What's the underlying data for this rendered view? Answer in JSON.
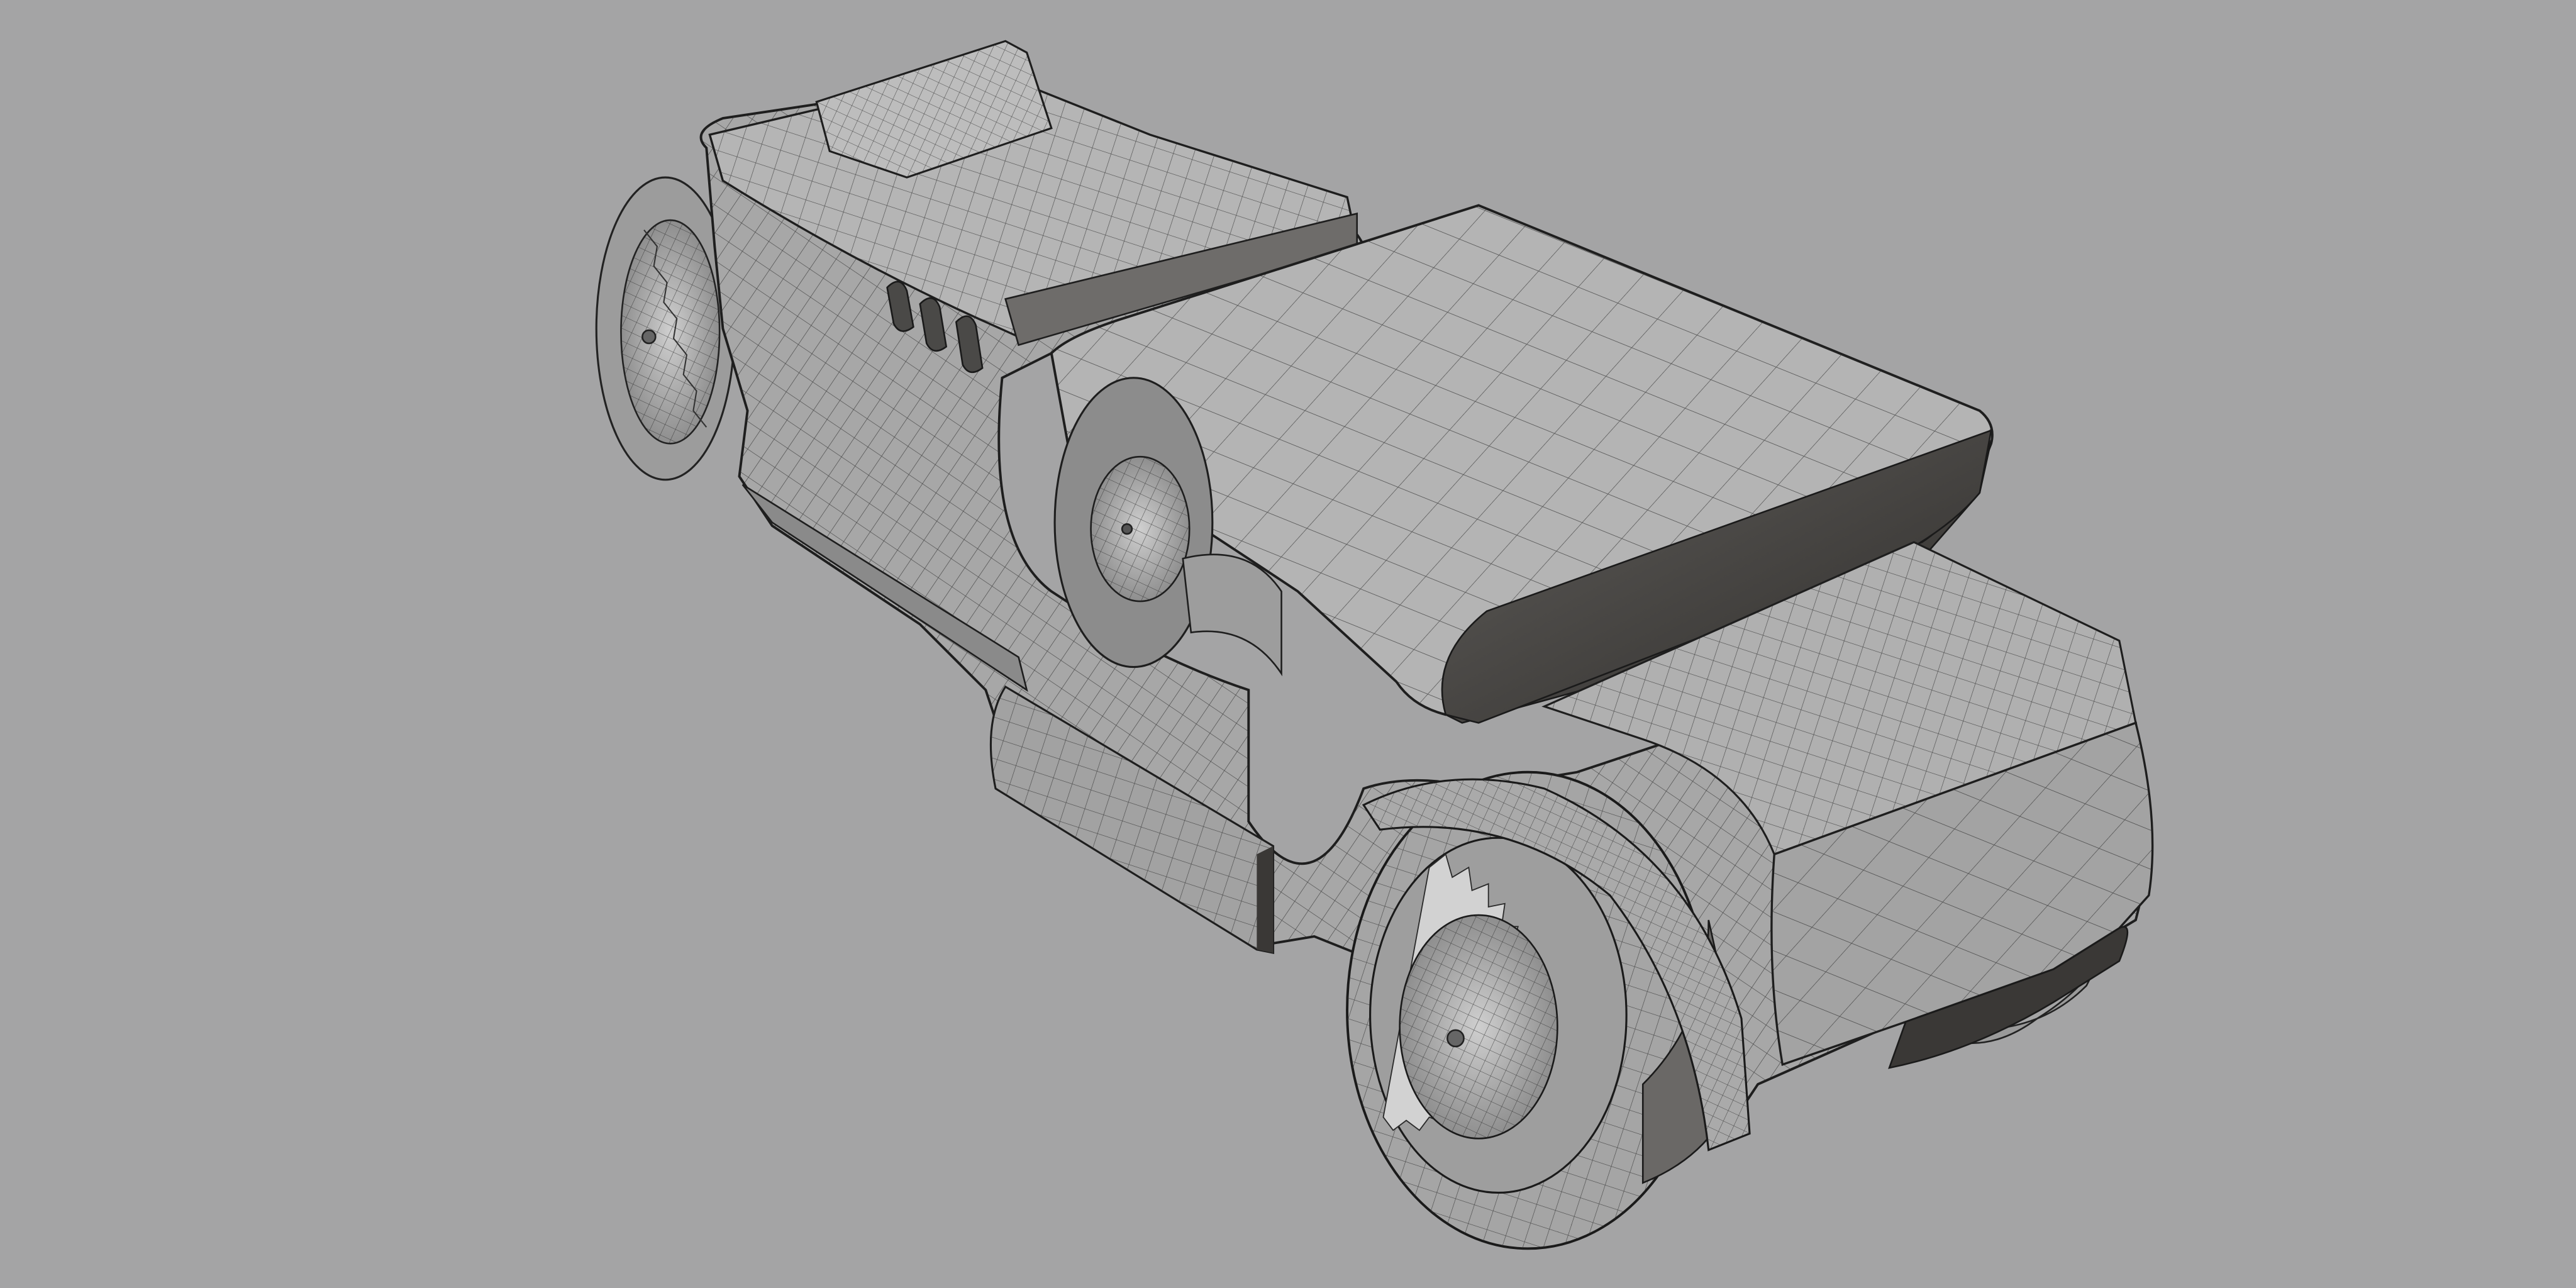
{
  "viewport": {
    "background": "#a4a4a5",
    "object": "wireframe-vehicle-model",
    "colors": {
      "surface_light": "#b9b9b9",
      "surface_mid": "#9d9d9d",
      "surface_dark": "#5f5d5a",
      "shadow": "#2e2c2a",
      "wire": "#2b2b2b"
    }
  }
}
